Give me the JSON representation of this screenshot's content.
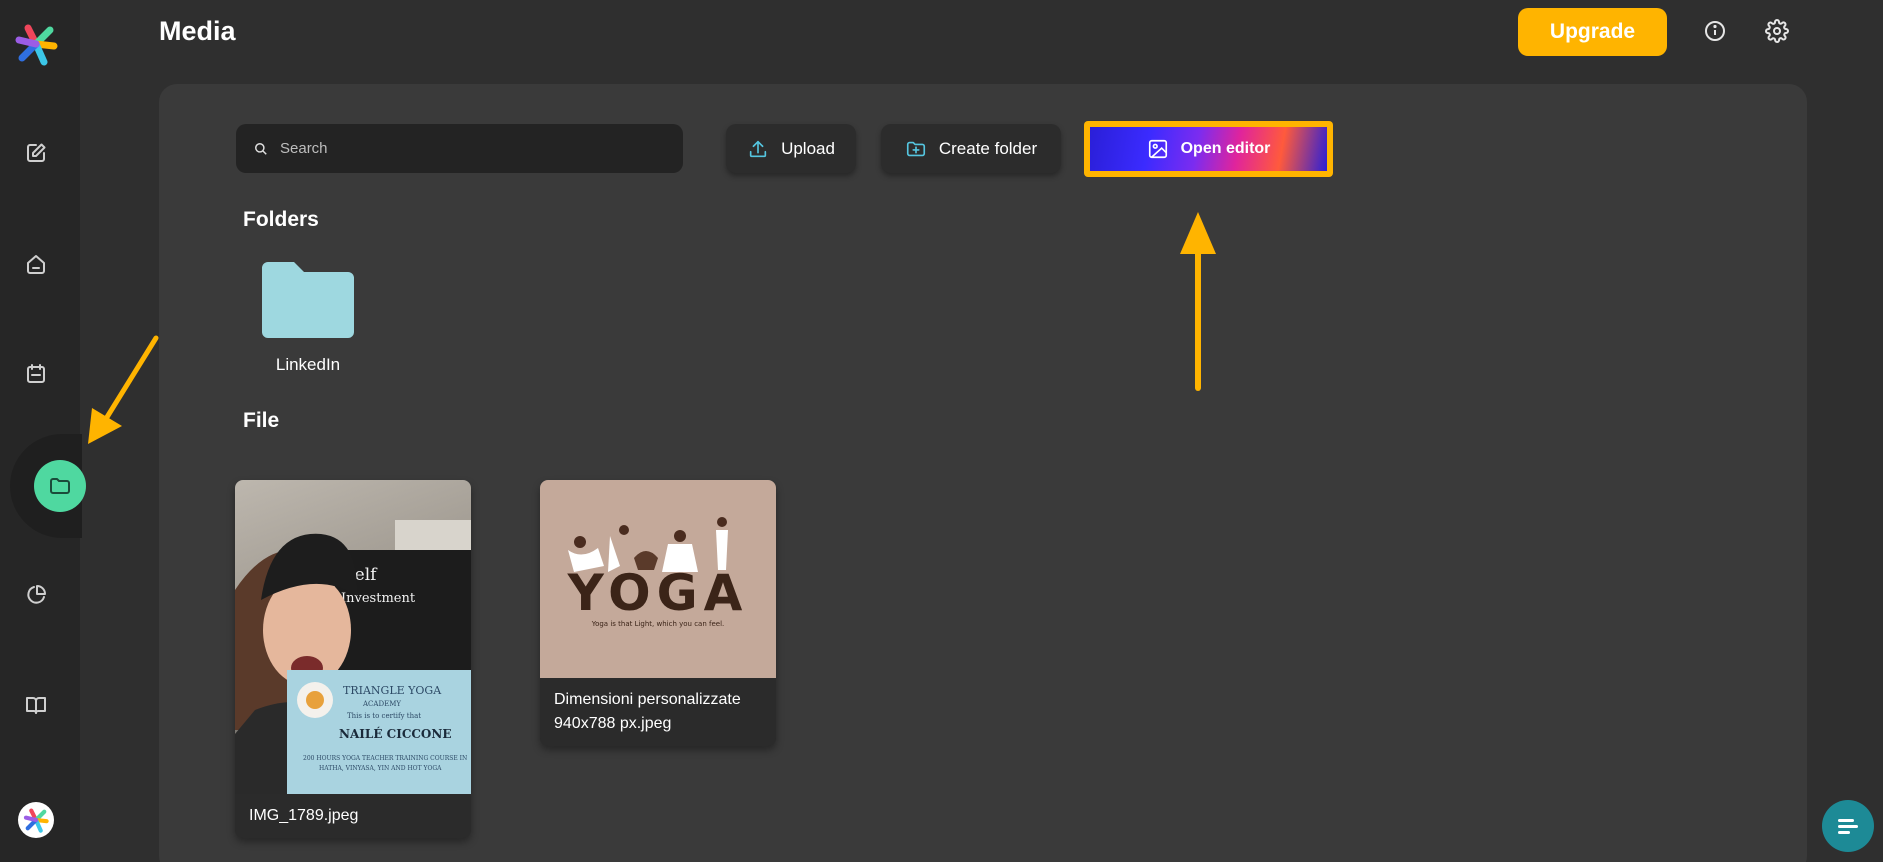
{
  "header": {
    "title": "Media",
    "upgrade_label": "Upgrade"
  },
  "toolbar": {
    "search_placeholder": "Search",
    "upload_label": "Upload",
    "create_folder_label": "Create folder",
    "open_editor_label": "Open editor"
  },
  "folders": {
    "heading": "Folders",
    "items": [
      {
        "name": "LinkedIn"
      }
    ]
  },
  "files": {
    "heading": "File",
    "items": [
      {
        "name": "IMG_1789.jpeg",
        "thumb_texts": [
          "Self",
          "Investment",
          "TRIANGLE YOGA",
          "ACADEMY",
          "This is to certify that",
          "NAILÉ CICCONE",
          "200 HOURS YOGA TEACHER TRAINING COURSE IN",
          "HATHA, VINYASA, YIN AND HOT YOGA"
        ]
      },
      {
        "name_line1": "Dimensioni personalizzate",
        "name_line2": "940x788 px.jpeg",
        "thumb_title": "YOGA",
        "thumb_caption": "Yoga is that Light, which you can feel."
      }
    ]
  },
  "colors": {
    "accent": "#ffb400",
    "active_nav": "#4fd8a0",
    "folder": "#9ed8e0",
    "chat": "#1d8a96"
  },
  "icons": {
    "sidebar": [
      "edit-icon",
      "home-icon",
      "calendar-icon",
      "folder-icon",
      "pie-chart-icon",
      "book-icon"
    ],
    "header": [
      "info-icon",
      "gear-icon"
    ]
  }
}
